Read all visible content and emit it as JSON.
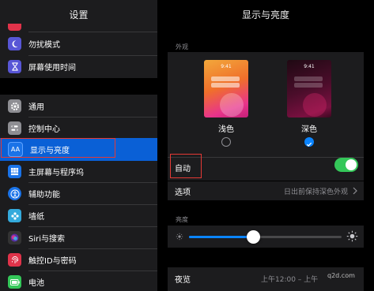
{
  "sidebar": {
    "title": "设置",
    "items": [
      {
        "label": "",
        "icon": "partial-red-icon",
        "color": "#e0334a"
      },
      {
        "label": "勿扰模式",
        "icon": "moon-icon",
        "color": "#5856d6"
      },
      {
        "label": "屏幕使用时间",
        "icon": "hourglass-icon",
        "color": "#5856d6"
      },
      {
        "label": "通用",
        "icon": "gear-icon",
        "color": "#8e8e93"
      },
      {
        "label": "控制中心",
        "icon": "sliders-icon",
        "color": "#8e8e93"
      },
      {
        "label": "显示与亮度",
        "icon": "aa-icon",
        "color": "#1a73e8",
        "glyph": "AA"
      },
      {
        "label": "主屏幕与程序坞",
        "icon": "grid-icon",
        "color": "#1a73e8"
      },
      {
        "label": "辅助功能",
        "icon": "accessibility-icon",
        "color": "#1a73e8"
      },
      {
        "label": "墙纸",
        "icon": "flower-icon",
        "color": "#34aadc"
      },
      {
        "label": "Siri与搜索",
        "icon": "siri-icon",
        "color": "#333333"
      },
      {
        "label": "触控ID与密码",
        "icon": "fingerprint-icon",
        "color": "#e0334a"
      },
      {
        "label": "电池",
        "icon": "battery-icon",
        "color": "#34c759"
      }
    ]
  },
  "main": {
    "title": "显示与亮度",
    "appearance": {
      "section_label": "外观",
      "light": {
        "time": "9:41",
        "label": "浅色",
        "selected": false
      },
      "dark": {
        "time": "9:41",
        "label": "深色",
        "selected": true
      }
    },
    "auto": {
      "label": "自动",
      "enabled": true
    },
    "options": {
      "label": "选项",
      "value": "日出前保持深色外观"
    },
    "brightness": {
      "section_label": "亮度",
      "level": 0.42
    },
    "night_shift": {
      "label": "夜览",
      "value": "上午12:00 – 上午"
    }
  },
  "watermark": {
    "text": "q2d.com"
  },
  "colors": {
    "accent": "#0a84ff",
    "toggle_on": "#34c759",
    "highlight_box": "#e53935"
  }
}
